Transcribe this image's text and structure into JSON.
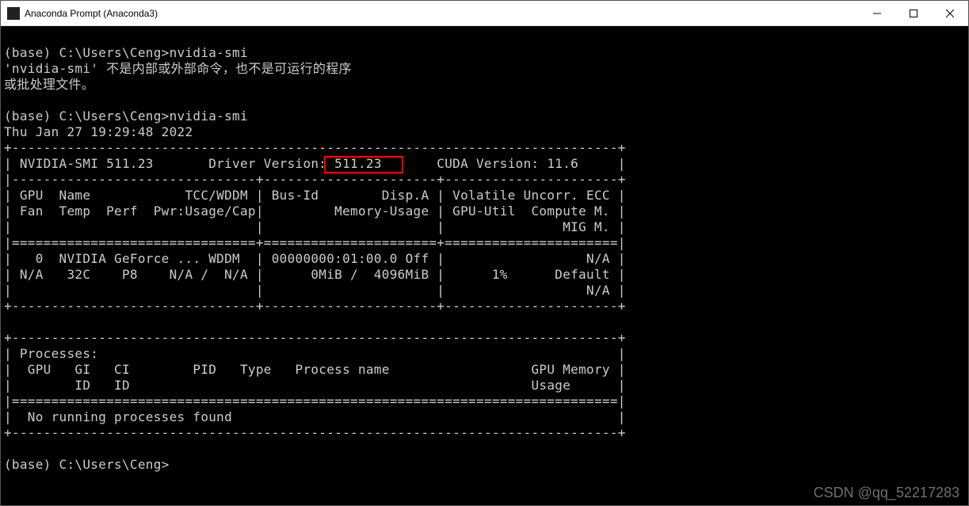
{
  "window": {
    "title": "Anaconda Prompt (Anaconda3)"
  },
  "terminal": {
    "line01": "",
    "line02": "(base) C:\\Users\\Ceng>nvidia-smi",
    "line03": "'nvidia-smi' 不是内部或外部命令，也不是可运行的程序",
    "line04": "或批处理文件。",
    "line05": "",
    "line06": "(base) C:\\Users\\Ceng>nvidia-smi",
    "line07": "Thu Jan 27 19:29:48 2022",
    "line08": "+-----------------------------------------------------------------------------+",
    "line09": "| NVIDIA-SMI 511.23       Driver Version: 511.23       CUDA Version: 11.6     |",
    "line10": "|-------------------------------+----------------------+----------------------+",
    "line11": "| GPU  Name            TCC/WDDM | Bus-Id        Disp.A | Volatile Uncorr. ECC |",
    "line12": "| Fan  Temp  Perf  Pwr:Usage/Cap|         Memory-Usage | GPU-Util  Compute M. |",
    "line13": "|                               |                      |               MIG M. |",
    "line14": "|===============================+======================+======================|",
    "line15": "|   0  NVIDIA GeForce ... WDDM  | 00000000:01:00.0 Off |                  N/A |",
    "line16": "| N/A   32C    P8    N/A /  N/A |      0MiB /  4096MiB |      1%      Default |",
    "line17": "|                               |                      |                  N/A |",
    "line18": "+-------------------------------+----------------------+----------------------+",
    "line19": "",
    "line20": "+-----------------------------------------------------------------------------+",
    "line21": "| Processes:                                                                  |",
    "line22": "|  GPU   GI   CI        PID   Type   Process name                  GPU Memory |",
    "line23": "|        ID   ID                                                   Usage      |",
    "line24": "|=============================================================================|",
    "line25": "|  No running processes found                                                 |",
    "line26": "+-----------------------------------------------------------------------------+",
    "line27": "",
    "line28": "(base) C:\\Users\\Ceng>"
  },
  "highlight": {
    "driver_version_value": "511.23"
  },
  "nvidia_smi": {
    "version": "511.23",
    "driver_version": "511.23",
    "cuda_version": "11.6",
    "timestamp": "Thu Jan 27 19:29:48 2022",
    "gpus": [
      {
        "index": 0,
        "name": "NVIDIA GeForce ...",
        "mode": "WDDM",
        "bus_id": "00000000:01:00.0",
        "disp_a": "Off",
        "ecc": "N/A",
        "fan": "N/A",
        "temp": "32C",
        "perf": "P8",
        "pwr_usage": "N/A",
        "pwr_cap": "N/A",
        "mem_used": "0MiB",
        "mem_total": "4096MiB",
        "gpu_util": "1%",
        "compute_m": "Default",
        "mig_m": "N/A"
      }
    ],
    "processes": "No running processes found"
  },
  "prompt": {
    "env": "(base)",
    "path": "C:\\Users\\Ceng",
    "command1": "nvidia-smi",
    "error_line1": "'nvidia-smi' 不是内部或外部命令，也不是可运行的程序",
    "error_line2": "或批处理文件。"
  },
  "watermark": {
    "text": "CSDN @qq_52217283"
  }
}
